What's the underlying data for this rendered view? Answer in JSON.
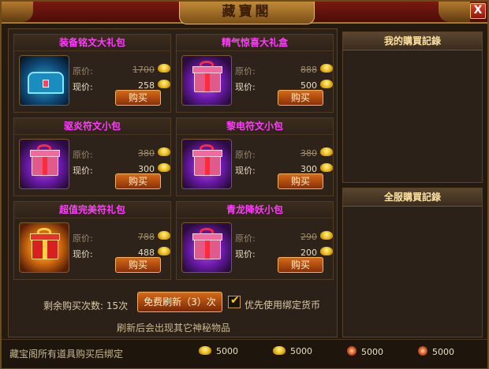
{
  "window": {
    "title": "藏寶閣",
    "close_label": "X"
  },
  "products": [
    {
      "name": "装备铭文大礼包",
      "orig_label": "原价:",
      "orig_price": "1700",
      "now_label": "现价:",
      "now_price": "258",
      "buy_label": "购买",
      "icon": "treasure-chest-icon"
    },
    {
      "name": "精气惊喜大礼盒",
      "orig_label": "原价:",
      "orig_price": "888",
      "now_label": "现价:",
      "now_price": "500",
      "buy_label": "购买",
      "icon": "gift-box-icon"
    },
    {
      "name": "驱炎符文小包",
      "orig_label": "原价:",
      "orig_price": "380",
      "now_label": "现价:",
      "now_price": "300",
      "buy_label": "购买",
      "icon": "gift-box-icon"
    },
    {
      "name": "黎电符文小包",
      "orig_label": "原价:",
      "orig_price": "380",
      "now_label": "现价:",
      "now_price": "300",
      "buy_label": "购买",
      "icon": "gift-box-icon"
    },
    {
      "name": "超值完美符礼包",
      "orig_label": "原价:",
      "orig_price": "788",
      "now_label": "现价:",
      "now_price": "488",
      "buy_label": "购买",
      "icon": "golden-gift-icon"
    },
    {
      "name": "青龙降妖小包",
      "orig_label": "原价:",
      "orig_price": "290",
      "now_label": "现价:",
      "now_price": "200",
      "buy_label": "购买",
      "icon": "gift-box-icon"
    }
  ],
  "controls": {
    "remaining_text": "剩余购买次数: 15次",
    "refresh_label": "免费刷新（3）次",
    "bound_currency_label": "优先使用绑定货币",
    "bound_currency_checked": true,
    "refresh_note": "刷新后会出现其它神秘物品"
  },
  "side": {
    "my_records_title": "我的購買記錄",
    "server_records_title": "全服購買記錄"
  },
  "footer": {
    "note": "藏宝阁所有道具购买后绑定",
    "currencies": [
      {
        "icon": "gold-ingot-icon",
        "amount": "5000"
      },
      {
        "icon": "bound-ingot-icon",
        "amount": "5000"
      },
      {
        "icon": "coin-icon",
        "amount": "5000"
      },
      {
        "icon": "bound-coin-icon",
        "amount": "5000"
      }
    ]
  }
}
